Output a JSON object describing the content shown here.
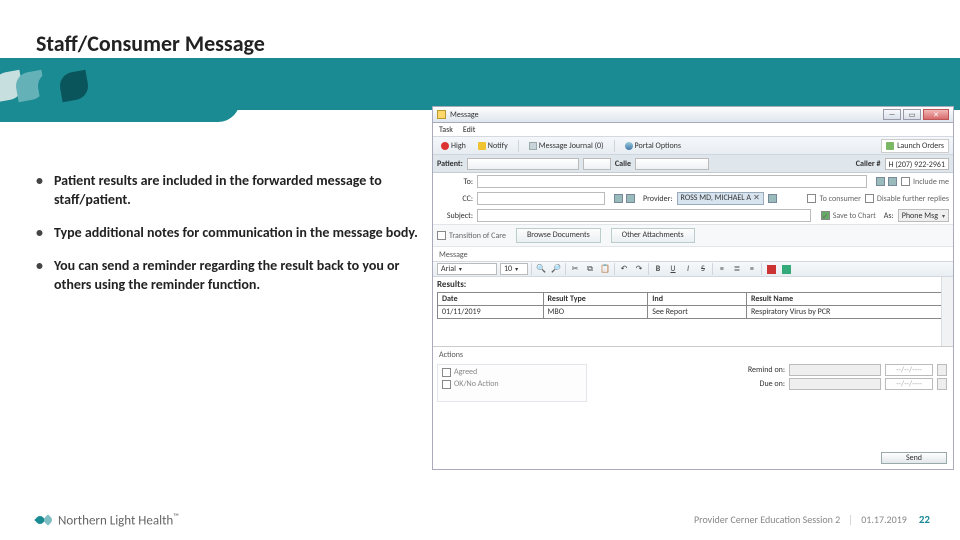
{
  "slide": {
    "title": "Staff/Consumer Message",
    "bullets": [
      "Patient results are included in the forwarded message to staff/patient.",
      "Type additional notes for communication in the message body.",
      "You can send a reminder regarding the result back to you or others using the reminder function."
    ]
  },
  "footer": {
    "brand": "Northern Light Health",
    "tm": "™",
    "course": "Provider Cerner Education Session 2",
    "date": "01.17.2019",
    "page": "22"
  },
  "app": {
    "window_title": "Message",
    "menus": {
      "task": "Task",
      "edit": "Edit"
    },
    "toolbar": {
      "high": "High",
      "notify": "Notify",
      "journal": "Message Journal (0)",
      "portal": "Portal Options",
      "launch": "Launch Orders"
    },
    "patient": {
      "label": "Patient:",
      "caller_label": "Calle",
      "callernum_label": "Caller #",
      "callernum_value": "H (207) 922-2961"
    },
    "to": {
      "label": "To:",
      "include_me": "Include me"
    },
    "cc": {
      "label": "CC:",
      "provider_label": "Provider:",
      "provider_value": "ROSS MD, MICHAEL A",
      "to_consumer": "To consumer",
      "disable_replies": "Disable further replies"
    },
    "subject": {
      "label": "Subject:",
      "save_chart": "Save to Chart",
      "as_label": "As:",
      "as_value": "Phone Msg"
    },
    "attachments": {
      "transition": "Transition of Care",
      "browse": "Browse Documents",
      "other": "Other Attachments"
    },
    "message_label": "Message",
    "editor": {
      "font": "Arial",
      "size": "10",
      "bold": "B",
      "italic": "I",
      "underline": "U",
      "strike": "S"
    },
    "results": {
      "heading": "Results:",
      "cols": {
        "date": "Date",
        "type": "Result Type",
        "ind": "Ind",
        "name": "Result Name"
      },
      "row": {
        "date": "01/11/2019",
        "type": "MBO",
        "ind": "See Report",
        "name": "Respiratory Virus by PCR"
      }
    },
    "actions": {
      "label": "Actions",
      "agreed": "Agreed",
      "oknoaction": "OK/No Action",
      "remind_on": "Remind on:",
      "due_on": "Due on:",
      "date_placeholder": "--/--/----"
    },
    "send": "Send"
  }
}
